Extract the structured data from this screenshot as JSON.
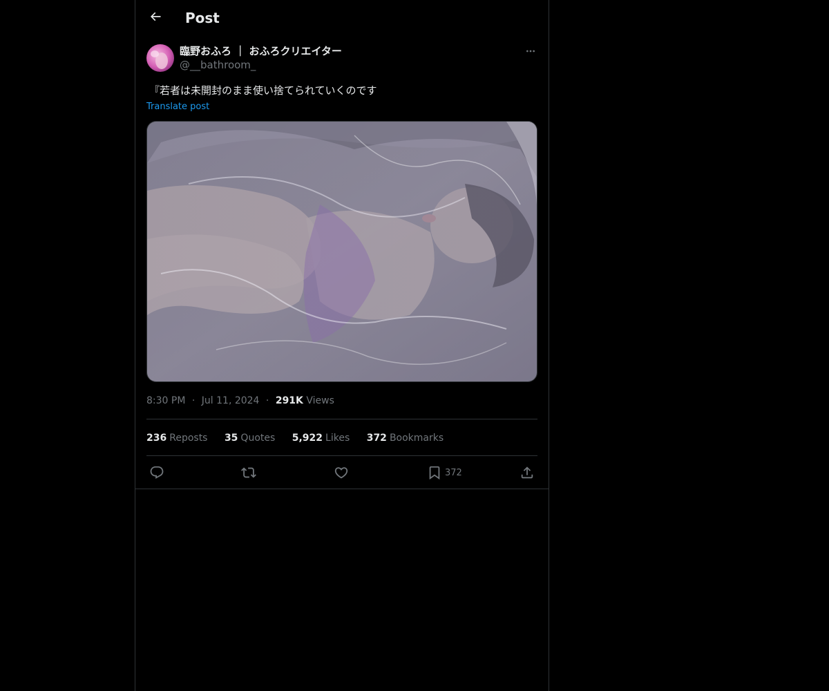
{
  "header": {
    "title": "Post"
  },
  "post": {
    "author": {
      "display_name": "臨野おふろ ｜ おふろクリエイター",
      "handle": "@__bathroom_"
    },
    "text": "『若者は未開封のまま使い捨てられていくのです",
    "translate_label": "Translate post",
    "time": "8:30 PM",
    "date": "Jul 11, 2024",
    "views_count": "291K",
    "views_label": "Views",
    "separator": "·",
    "stats": {
      "reposts": {
        "count": "236",
        "label": "Reposts"
      },
      "quotes": {
        "count": "35",
        "label": "Quotes"
      },
      "likes": {
        "count": "5,922",
        "label": "Likes"
      },
      "bookmarks": {
        "count": "372",
        "label": "Bookmarks"
      }
    },
    "actions": {
      "bookmark_count": "372"
    }
  },
  "colors": {
    "background": "#000000",
    "text_primary": "#e7e9ea",
    "text_secondary": "#71767b",
    "link": "#1d9bf0",
    "border": "#2f3336"
  }
}
